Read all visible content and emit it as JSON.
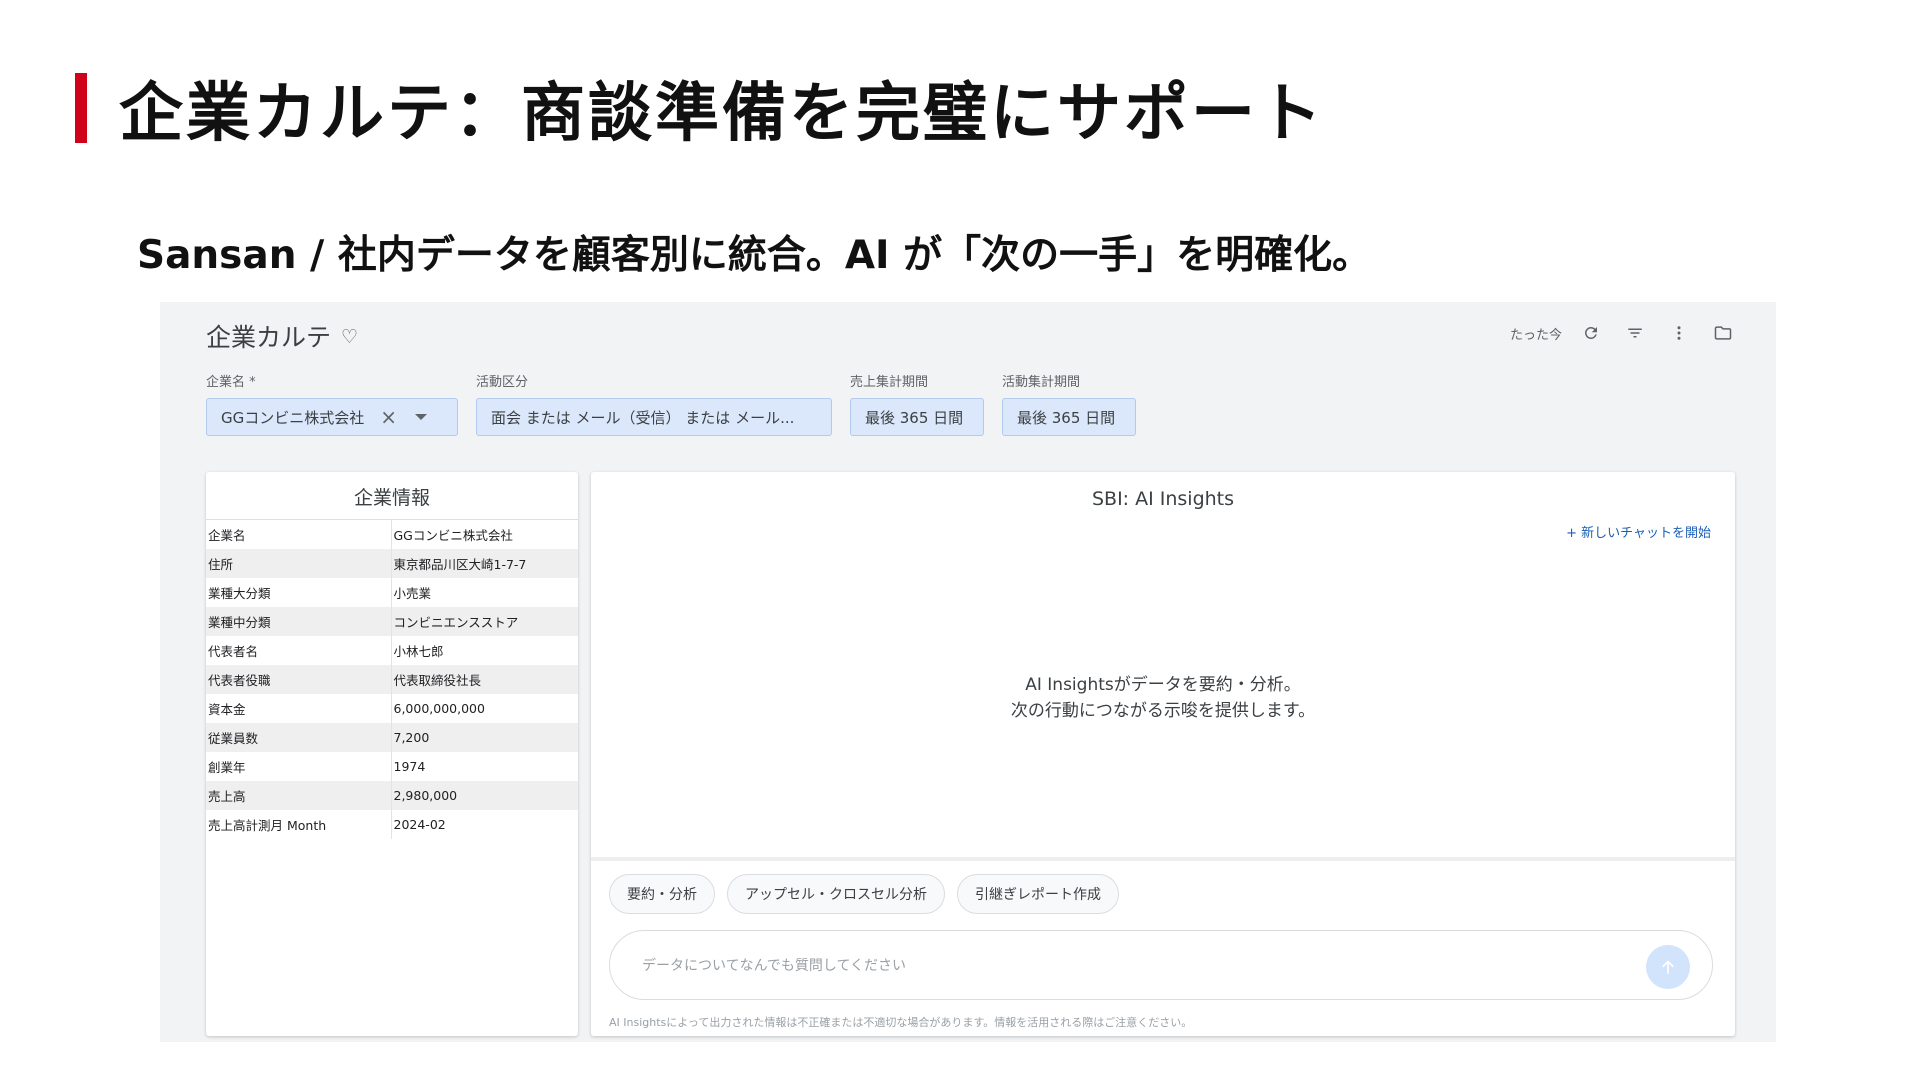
{
  "slide": {
    "title": "企業カルテ：商談準備を完璧にサポート",
    "subtitle": "Sansan / 社内データを顧客別に統合。AI が「次の一手」を明確化。",
    "accent_color": "#d0021b"
  },
  "app": {
    "title": "企業カルテ",
    "favorite_icon": "heart-outline-icon",
    "toolbar": {
      "updated_label": "たった今",
      "icons": [
        "refresh-icon",
        "filter-icon",
        "more-vert-icon",
        "folder-icon"
      ]
    },
    "filters": {
      "company": {
        "label": "企業名 *",
        "value": "GGコンビニ株式会社",
        "clear_icon": "close-icon",
        "dropdown_icon": "arrow-drop-down-icon"
      },
      "activity": {
        "label": "活動区分",
        "value": "面会 または メール（受信） または メール..."
      },
      "sales_period": {
        "label": "売上集計期間",
        "value": "最後 365 日間"
      },
      "activity_period": {
        "label": "活動集計期間",
        "value": "最後 365 日間"
      }
    },
    "company_info": {
      "title": "企業情報",
      "rows": [
        {
          "key": "企業名",
          "value": "GGコンビニ株式会社"
        },
        {
          "key": "住所",
          "value": "東京都品川区大崎1-7-7"
        },
        {
          "key": "業種大分類",
          "value": "小売業"
        },
        {
          "key": "業種中分類",
          "value": "コンビニエンスストア"
        },
        {
          "key": "代表者名",
          "value": "小林七郎"
        },
        {
          "key": "代表者役職",
          "value": "代表取締役社長"
        },
        {
          "key": "資本金",
          "value": "6,000,000,000"
        },
        {
          "key": "従業員数",
          "value": "7,200"
        },
        {
          "key": "創業年",
          "value": "1974"
        },
        {
          "key": "売上高",
          "value": "2,980,000"
        },
        {
          "key": "売上高計測月 Month",
          "value": "2024-02"
        }
      ]
    },
    "insights": {
      "title": "SBI: AI Insights",
      "new_chat_label": "+ 新しいチャットを開始",
      "intro_line1": "AI Insightsがデータを要約・分析。",
      "intro_line2": "次の行動につながる示唆を提供します。",
      "chips": [
        "要約・分析",
        "アップセル・クロスセル分析",
        "引継ぎレポート作成"
      ],
      "input_placeholder": "データについてなんでも質問してください",
      "send_icon": "arrow-up-icon",
      "disclaimer": "AI Insightsによって出力された情報は不正確または不適切な場合があります。情報を活用される際はご注意ください。"
    }
  }
}
